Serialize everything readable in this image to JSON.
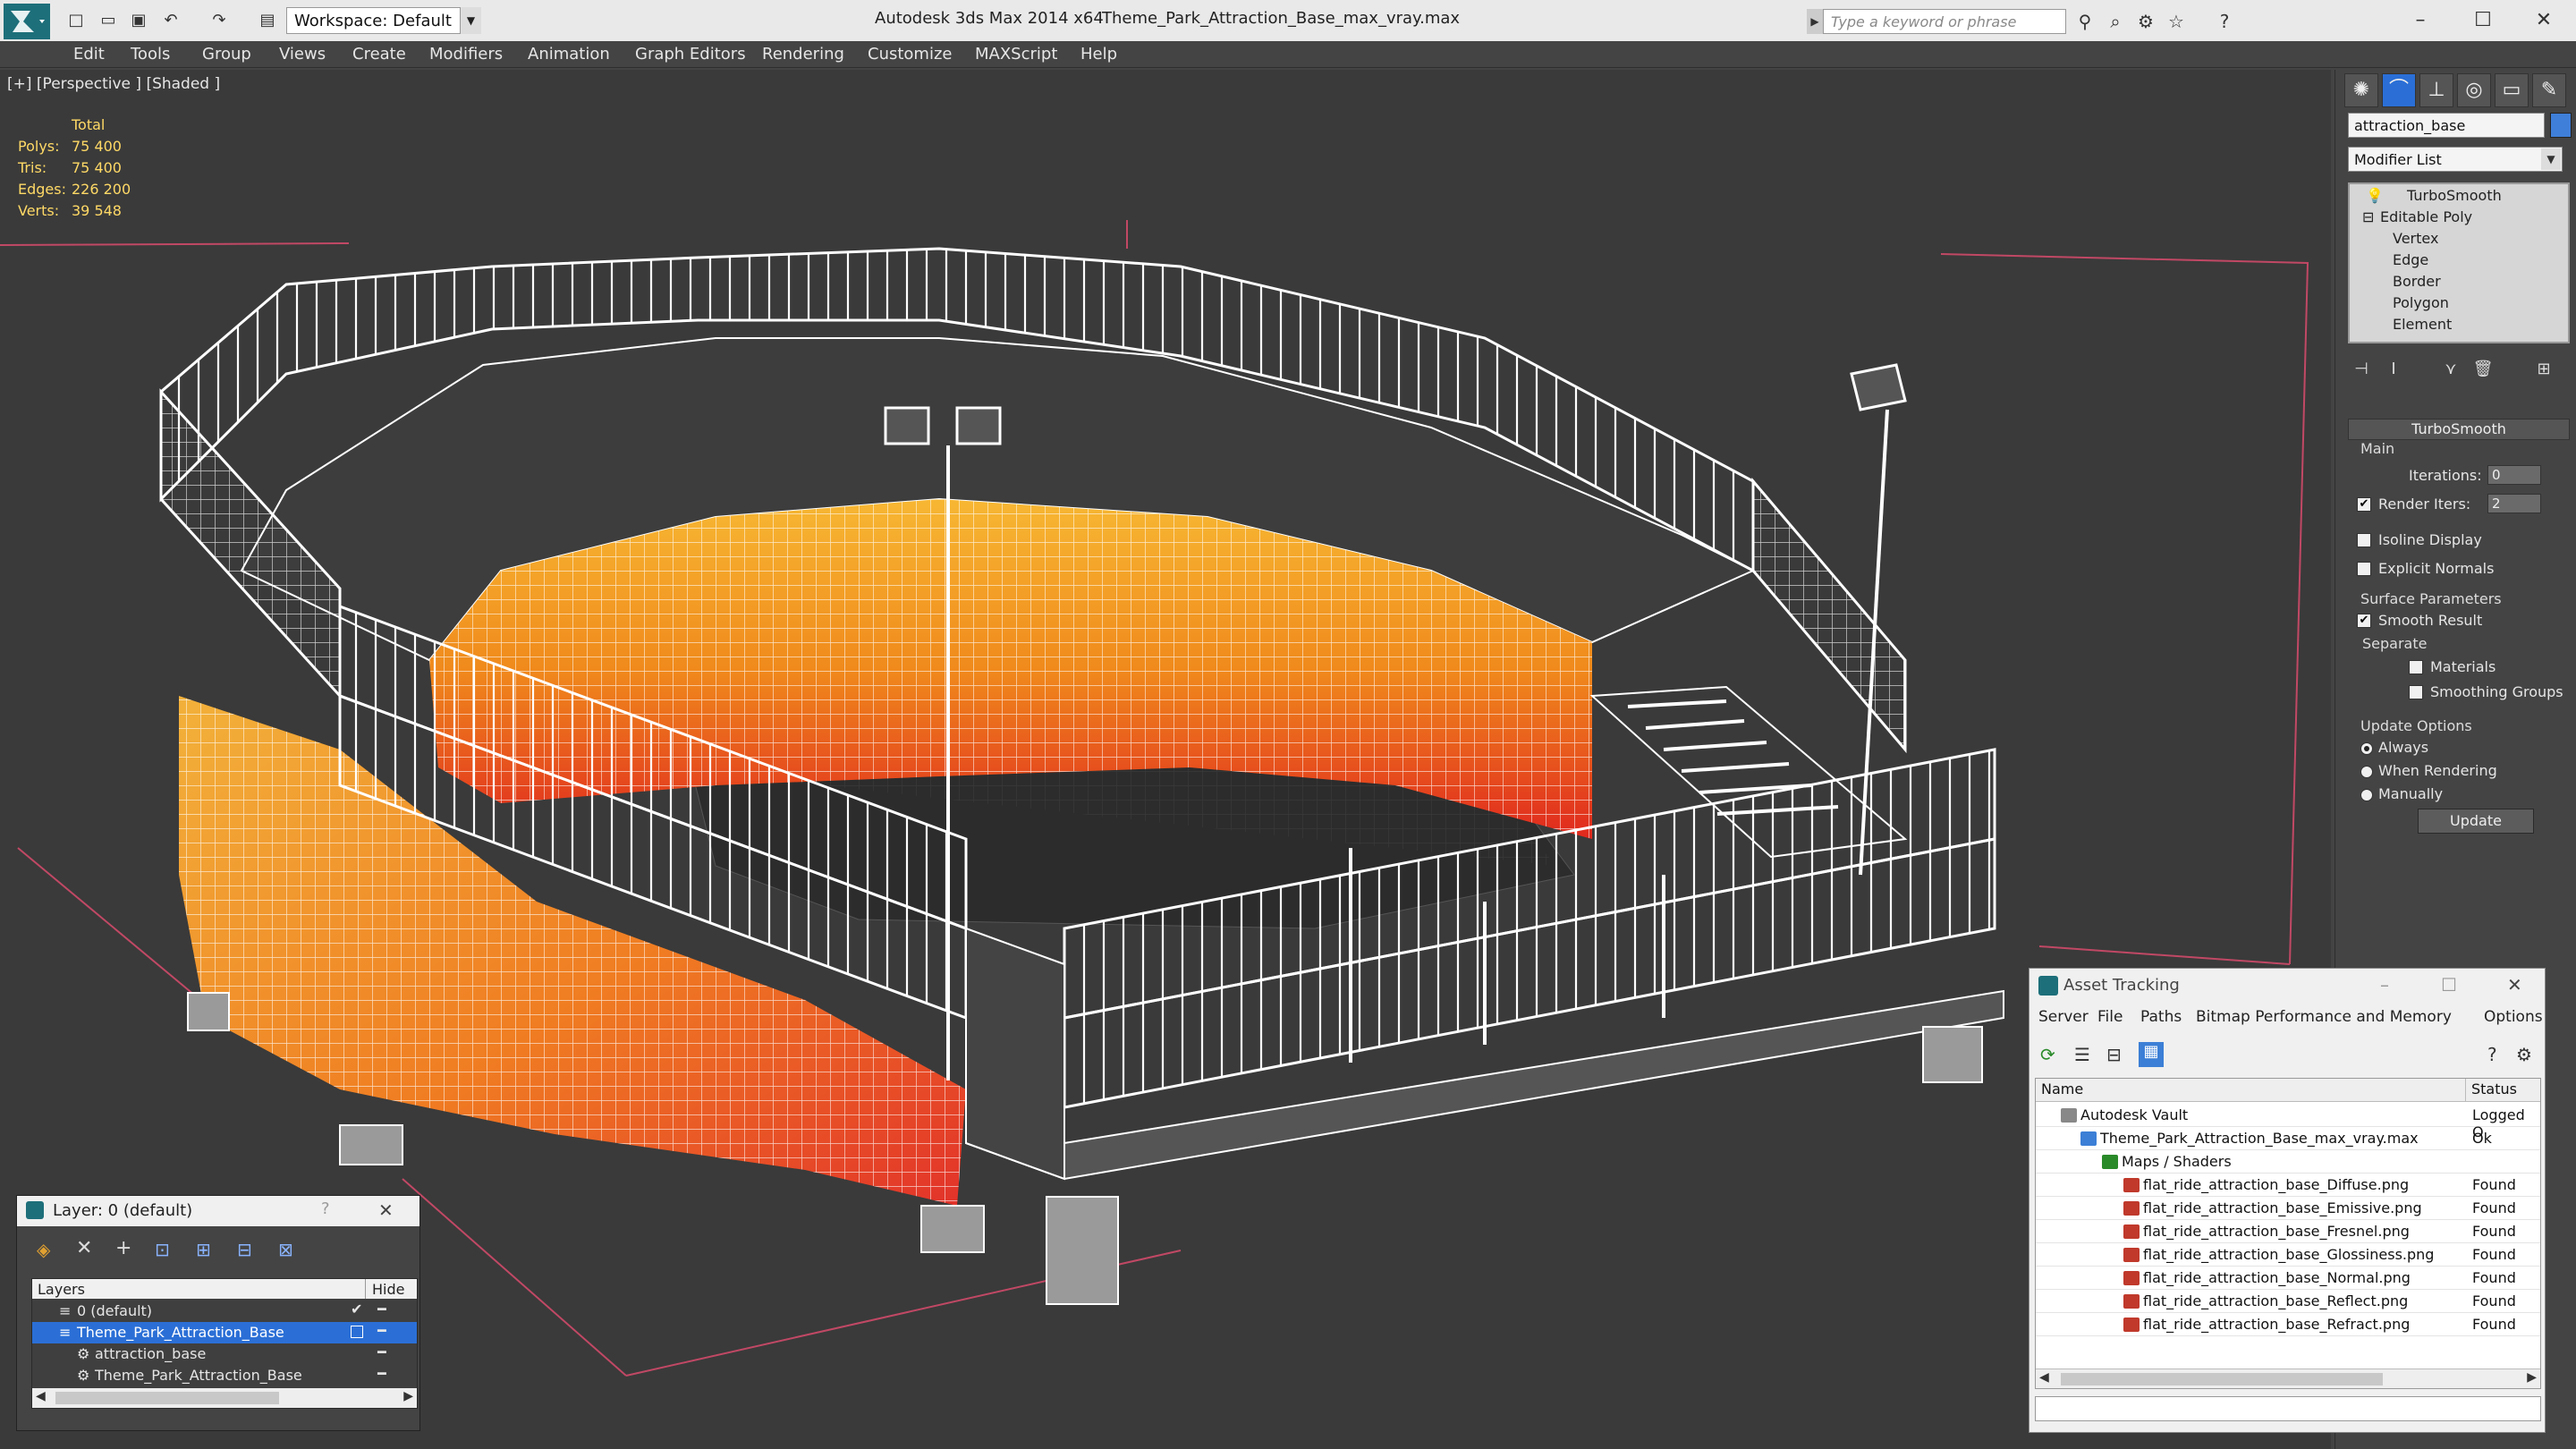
{
  "titlebar": {
    "workspace": "Workspace: Default",
    "app_title": "Autodesk 3ds Max  2014 x64",
    "file_title": "Theme_Park_Attraction_Base_max_vray.max",
    "search_placeholder": "Type a keyword or phrase"
  },
  "menu": [
    "Edit",
    "Tools",
    "Group",
    "Views",
    "Create",
    "Modifiers",
    "Animation",
    "Graph Editors",
    "Rendering",
    "Customize",
    "MAXScript",
    "Help"
  ],
  "viewport": {
    "label": "[+] [Perspective ] [Shaded ]",
    "stats": {
      "header": "Total",
      "polys_label": "Polys:",
      "polys": "75 400",
      "tris_label": "Tris:",
      "tris": "75 400",
      "edges_label": "Edges:",
      "edges": "226 200",
      "verts_label": "Verts:",
      "verts": "39 548"
    }
  },
  "command_panel": {
    "object_name": "attraction_base",
    "object_color": "#3f7fd9",
    "modifier_list": "Modifier List",
    "stack": [
      "TurboSmooth",
      "Editable Poly",
      "Vertex",
      "Edge",
      "Border",
      "Polygon",
      "Element"
    ],
    "rollout_title": "TurboSmooth",
    "main_label": "Main",
    "iterations_label": "Iterations:",
    "iterations": "0",
    "render_iters_label": "Render Iters:",
    "render_iters": "2",
    "isoline_label": "Isoline Display",
    "explicit_normals_label": "Explicit Normals",
    "surface_params_label": "Surface Parameters",
    "smooth_result_label": "Smooth Result",
    "separate_label": "Separate",
    "materials_label": "Materials",
    "smoothing_groups_label": "Smoothing Groups",
    "update_options_label": "Update Options",
    "always_label": "Always",
    "when_rendering_label": "When Rendering",
    "manually_label": "Manually",
    "update_button": "Update"
  },
  "asset_tracking": {
    "title": "Asset Tracking",
    "menu": [
      "Server",
      "File",
      "Paths",
      "Bitmap Performance and Memory",
      "Options"
    ],
    "col_name": "Name",
    "col_status": "Status",
    "rows": [
      {
        "name": "Autodesk Vault",
        "status": "Logged O"
      },
      {
        "name": "Theme_Park_Attraction_Base_max_vray.max",
        "status": "Ok"
      },
      {
        "name": "Maps / Shaders",
        "status": ""
      },
      {
        "name": "flat_ride_attraction_base_Diffuse.png",
        "status": "Found"
      },
      {
        "name": "flat_ride_attraction_base_Emissive.png",
        "status": "Found"
      },
      {
        "name": "flat_ride_attraction_base_Fresnel.png",
        "status": "Found"
      },
      {
        "name": "flat_ride_attraction_base_Glossiness.png",
        "status": "Found"
      },
      {
        "name": "flat_ride_attraction_base_Normal.png",
        "status": "Found"
      },
      {
        "name": "flat_ride_attraction_base_Reflect.png",
        "status": "Found"
      },
      {
        "name": "flat_ride_attraction_base_Refract.png",
        "status": "Found"
      }
    ]
  },
  "layer_dialog": {
    "title": "Layer: 0 (default)",
    "help": "?",
    "col_layers": "Layers",
    "col_hide": "Hide",
    "rows": [
      "0 (default)",
      "Theme_Park_Attraction_Base",
      "attraction_base",
      "Theme_Park_Attraction_Base"
    ]
  },
  "colors": {
    "viewport_bg": "#3a3a3a",
    "wire": "#ffffff",
    "selection_blue": "#2b6fd6",
    "stats_yellow": "#ffd966"
  }
}
